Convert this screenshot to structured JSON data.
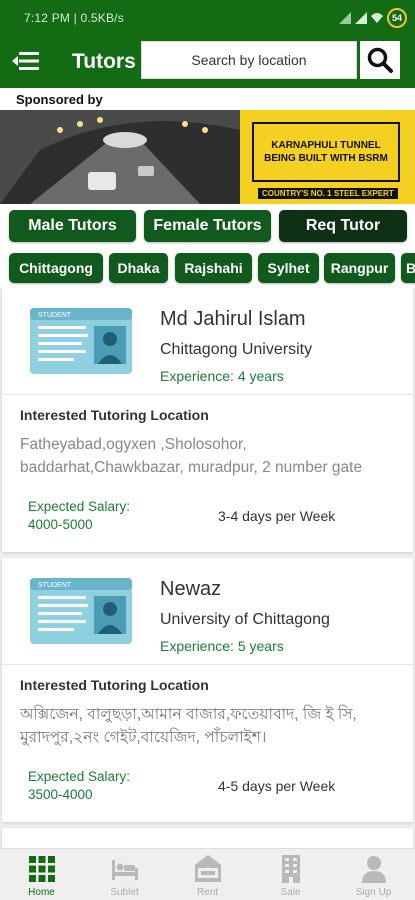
{
  "status_bar": {
    "time": "7:12 PM | 0.5KB/s",
    "battery": "54"
  },
  "app_bar": {
    "title": "Tutors",
    "search_placeholder": "Search by location"
  },
  "sponsored": {
    "label": "Sponsored by",
    "banner_line1": "KARNAPHULI TUNNEL",
    "banner_line2": "BEING BUILT WITH BSRM",
    "banner_sub": "COUNTRY'S NO. 1 STEEL EXPERT"
  },
  "filters": [
    {
      "label": "Male Tutors"
    },
    {
      "label": "Female Tutors"
    },
    {
      "label": "Req Tutor"
    }
  ],
  "cities": [
    {
      "label": "Chittagong"
    },
    {
      "label": "Dhaka"
    },
    {
      "label": "Rajshahi"
    },
    {
      "label": "Sylhet"
    },
    {
      "label": "Rangpur"
    },
    {
      "label": "B"
    }
  ],
  "id_card_text": "STUDENT",
  "tutors": [
    {
      "name": "Md Jahirul Islam",
      "university": "Chittagong University",
      "experience": "Experience: 4 years",
      "location_label": "Interested Tutoring Location",
      "location": "Fatheyabad,ogyxen ,Sholosohor, baddarhat,Chawkbazar, muradpur,  2 number gate",
      "salary_label": "Expected Salary:",
      "salary": "4000-5000",
      "days": "3-4 days per Week"
    },
    {
      "name": "Newaz",
      "university": "University of Chittagong",
      "experience": "Experience: 5 years",
      "location_label": "Interested Tutoring Location",
      "location": "অক্সিজেন, বালুছড়া,আমান বাজার,ফতেয়াবাদ, জি ই সি, মুরাদপুর,২নং গেইট,বায়েজিদ, পাঁচলাইশ।",
      "salary_label": "Expected Salary:",
      "salary": "3500-4000",
      "days": "4-5 days per Week"
    }
  ],
  "bottom_nav": [
    {
      "label": "Home",
      "icon": "grid-icon"
    },
    {
      "label": "Sublet",
      "icon": "bed-icon"
    },
    {
      "label": "Rent",
      "icon": "rent-sign-icon"
    },
    {
      "label": "Sale",
      "icon": "building-icon"
    },
    {
      "label": "Sign Up",
      "icon": "person-icon"
    }
  ]
}
